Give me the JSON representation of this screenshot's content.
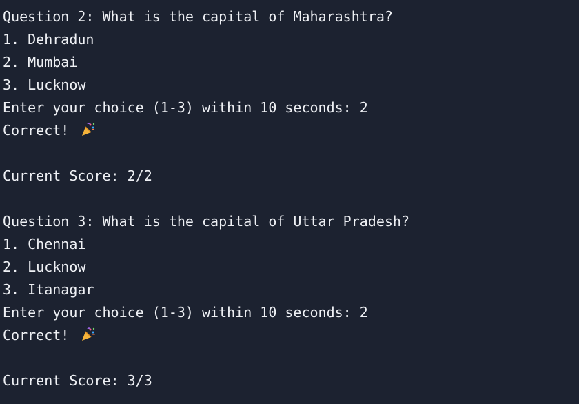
{
  "terminal": {
    "q2": {
      "question": "Question 2: What is the capital of Maharashtra?",
      "options": [
        "1. Dehradun",
        "2. Mumbai",
        "3. Lucknow"
      ],
      "prompt": "Enter your choice (1-3) within 10 seconds: 2",
      "result": "Correct! ",
      "score": "Current Score: 2/2"
    },
    "q3": {
      "question": "Question 3: What is the capital of Uttar Pradesh?",
      "options": [
        "1. Chennai",
        "2. Lucknow",
        "3. Itanagar"
      ],
      "prompt": "Enter your choice (1-3) within 10 seconds: 2",
      "result": "Correct! ",
      "score": "Current Score: 3/3"
    },
    "icons": {
      "celebration": "party-popper-icon"
    },
    "colors": {
      "background": "#1c2230",
      "text": "#eef0f4"
    }
  }
}
